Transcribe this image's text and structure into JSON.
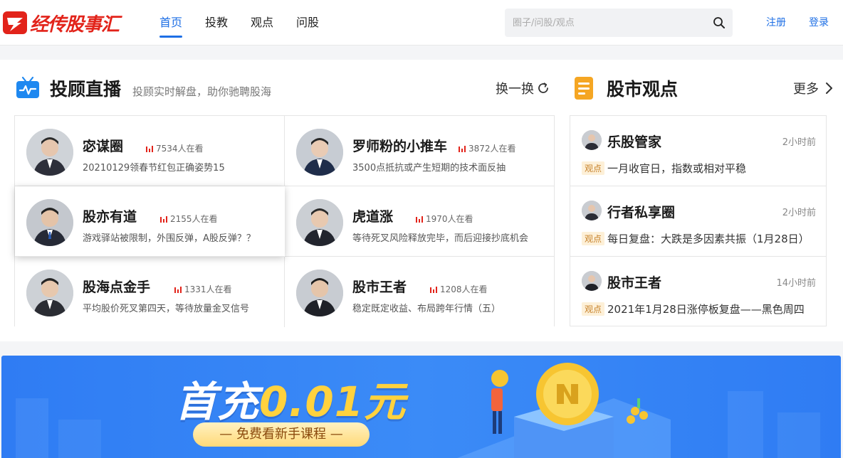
{
  "header": {
    "logo_text": "经传股事汇",
    "nav": [
      {
        "label": "首页",
        "active": true
      },
      {
        "label": "投教",
        "active": false
      },
      {
        "label": "观点",
        "active": false
      },
      {
        "label": "问股",
        "active": false
      }
    ],
    "search_placeholder": "圈子/问股/观点",
    "register": "注册",
    "login": "登录"
  },
  "live": {
    "title": "投顾直播",
    "subtitle": "投顾实时解盘，助你驰聘股海",
    "swap_label": "换一换",
    "items": [
      {
        "name": "宓谋圈",
        "viewers": "7534人在看",
        "desc": "20210129领春节红包正确姿势15"
      },
      {
        "name": "罗师粉的小推车",
        "viewers": "3872人在看",
        "desc": "3500点抵抗或产生短期的技术面反抽"
      },
      {
        "name": "股亦有道",
        "viewers": "2155人在看",
        "desc": "游戏驿站被限制，外围反弹，A股反弹？？"
      },
      {
        "name": "虎道涨",
        "viewers": "1970人在看",
        "desc": "等待死叉风险释放完毕，而后迎接抄底机会"
      },
      {
        "name": "股海点金手",
        "viewers": "1331人在看",
        "desc": "平均股价死叉第四天，等待放量金叉信号"
      },
      {
        "name": "股市王者",
        "viewers": "1208人在看",
        "desc": "稳定既定收益、布局跨年行情（五）"
      }
    ]
  },
  "opinions": {
    "title": "股市观点",
    "more_label": "更多",
    "tag": "观点",
    "items": [
      {
        "name": "乐股管家",
        "time": "2小时前",
        "text": "一月收官日，指数或相对平稳"
      },
      {
        "name": "行者私享圈",
        "time": "2小时前",
        "text": "每日复盘：大跌是多因素共振（1月28日）"
      },
      {
        "name": "股市王者",
        "time": "14小时前",
        "text": "2021年1月28日涨停板复盘——黑色周四"
      }
    ]
  },
  "banner": {
    "title_prefix": "首充",
    "title_amount": "0.01元",
    "pill": "— 免费看新手课程 —"
  },
  "colors": {
    "brand_red": "#e2231a",
    "accent_blue": "#1e6fe5",
    "viewer_bars": "#e2231a",
    "tag_bg": "#fdf0d8",
    "tag_fg": "#c7822a"
  },
  "icons": [
    "logo-icon",
    "search-icon",
    "tv-icon",
    "refresh-icon",
    "note-icon",
    "chevron-right-icon",
    "bars-icon"
  ]
}
